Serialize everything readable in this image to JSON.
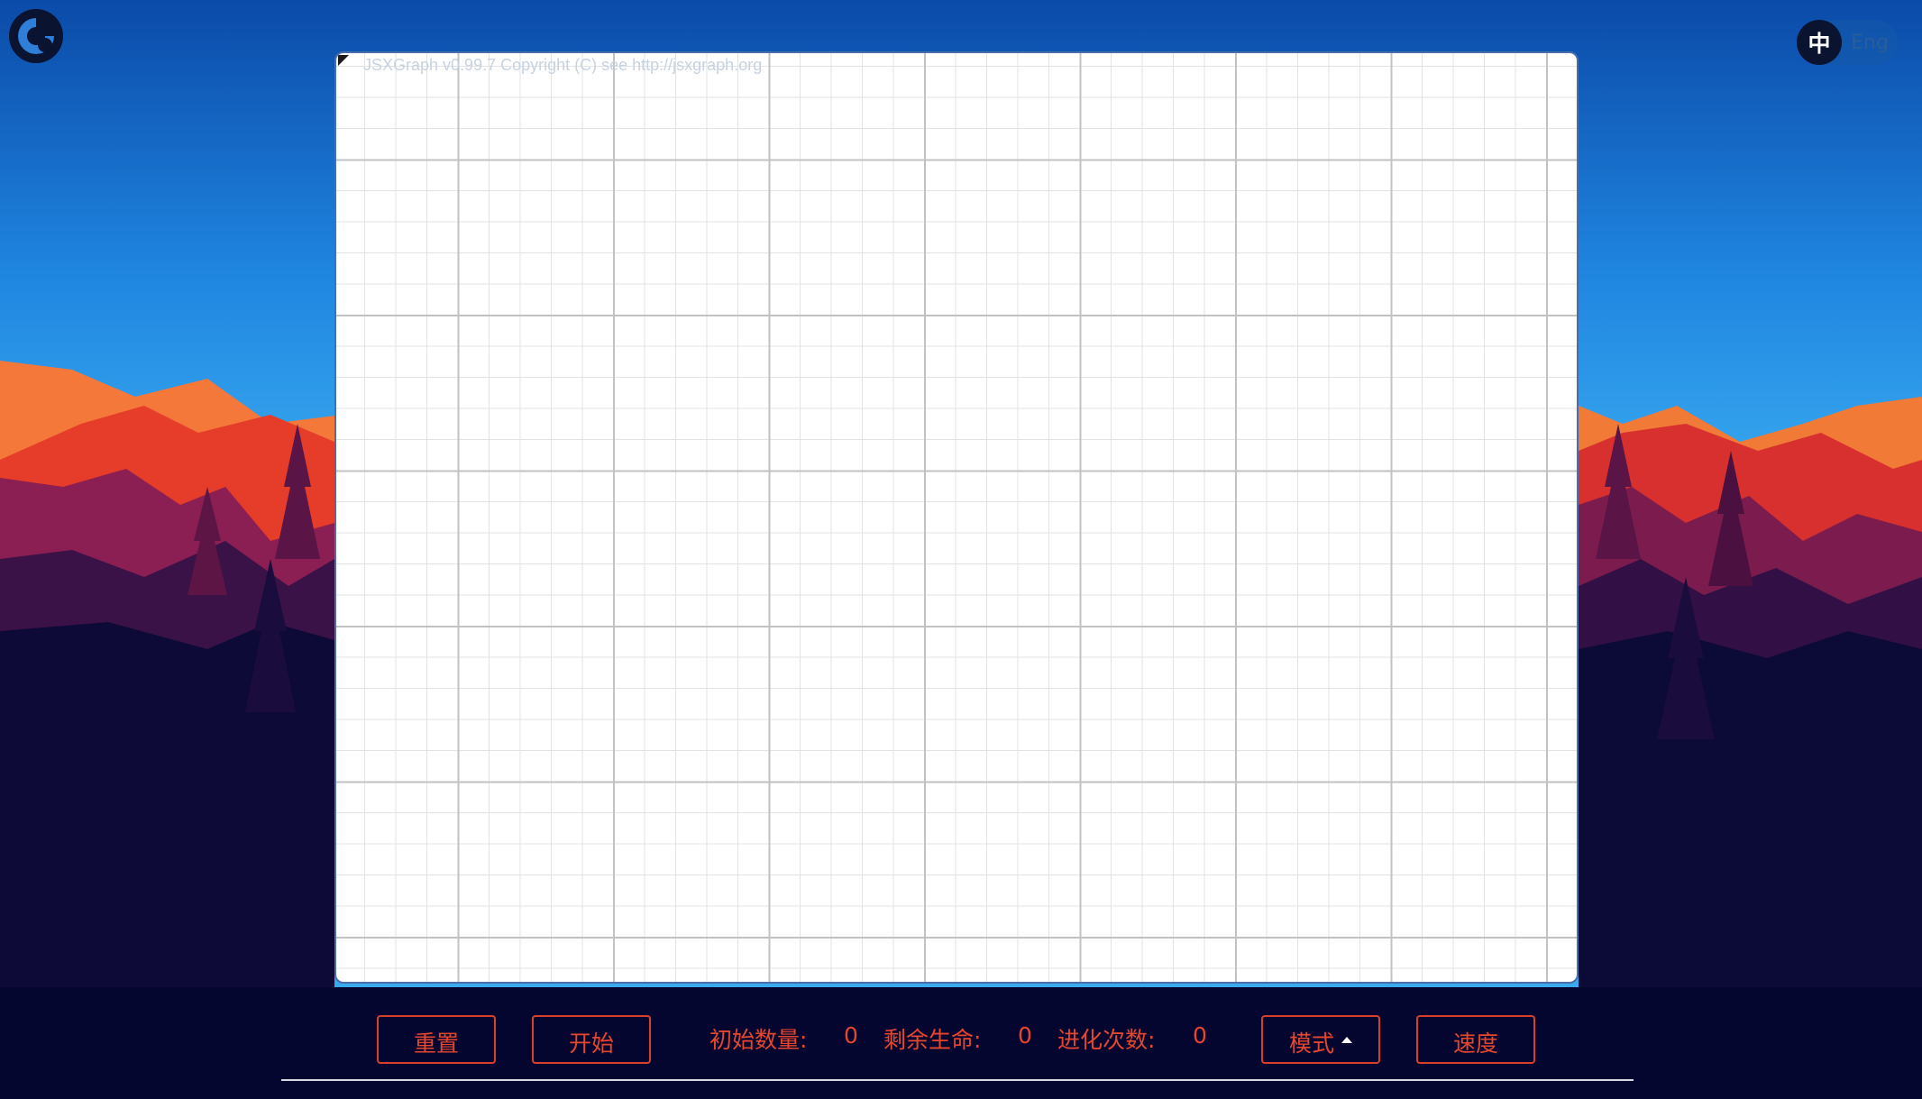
{
  "board": {
    "copyright": "JSXGraph v0.99.7 Copyright (C) see http://jsxgraph.org"
  },
  "language": {
    "zh": "中",
    "en": "Eng"
  },
  "controls": {
    "reset_label": "重置",
    "start_label": "开始",
    "initial_count_label": "初始数量:",
    "initial_count_value": "0",
    "remaining_life_label": "剩余生命:",
    "remaining_life_value": "0",
    "evolution_count_label": "进化次数:",
    "evolution_count_value": "0",
    "mode_label": "模式",
    "speed_label": "速度"
  },
  "icons": {
    "logo": "app-logo-icon",
    "mode_caret": "caret-up-icon",
    "board_nav": "board-navigation-icon"
  },
  "colors": {
    "accent": "#e5462e",
    "board_border": "#4a6ea8",
    "sky_top": "#0b4aa8",
    "sky_bottom": "#2fa0ee"
  }
}
